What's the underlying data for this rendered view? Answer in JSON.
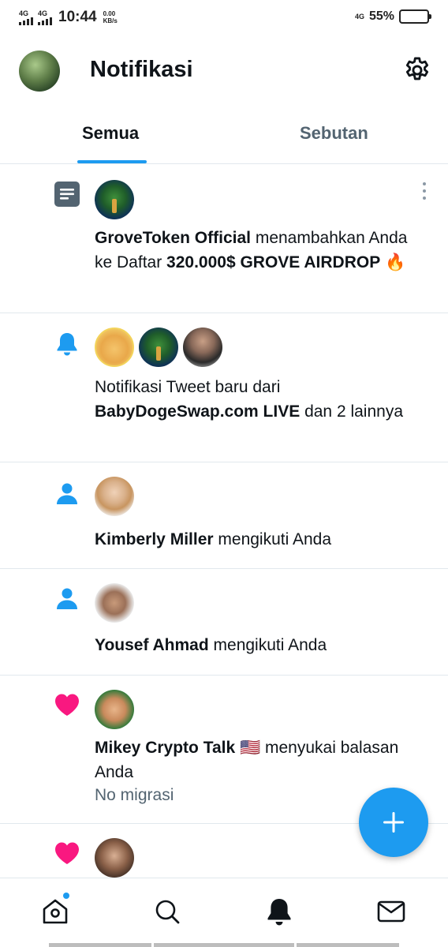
{
  "status_bar": {
    "net1": "4G",
    "net2": "4G",
    "time": "10:44",
    "speed_value": "0.00",
    "speed_unit": "KB/s",
    "net3": "4G",
    "battery_percent": "55%",
    "battery_level": 0.55
  },
  "header": {
    "title": "Notifikasi",
    "settings_icon": "gear-icon"
  },
  "tabs": [
    {
      "label": "Semua",
      "selected": true
    },
    {
      "label": "Sebutan",
      "selected": false
    }
  ],
  "notifications": [
    {
      "icon": "list-icon",
      "parts": [
        {
          "text": "GroveToken Official",
          "bold": true
        },
        {
          "text": " menambahkan Anda ke Daftar ",
          "bold": false
        },
        {
          "text": "320.000$ GROVE AIRDROP",
          "bold": true
        },
        {
          "text": " 🔥",
          "bold": false
        }
      ]
    },
    {
      "icon": "bell-icon",
      "parts": [
        {
          "text": "Notifikasi Tweet baru dari ",
          "bold": false
        },
        {
          "text": "BabyDogeSwap.com LIVE",
          "bold": true
        },
        {
          "text": " dan 2 lainnya",
          "bold": false
        }
      ]
    },
    {
      "icon": "person-icon",
      "parts": [
        {
          "text": "Kimberly Miller",
          "bold": true
        },
        {
          "text": " mengikuti Anda",
          "bold": false
        }
      ]
    },
    {
      "icon": "person-icon",
      "parts": [
        {
          "text": "Yousef Ahmad",
          "bold": true
        },
        {
          "text": " mengikuti Anda",
          "bold": false
        }
      ]
    },
    {
      "icon": "heart-icon",
      "parts": [
        {
          "text": "Mikey Crypto Talk",
          "bold": true
        },
        {
          "text": " 🇺🇸 menyukai balasan Anda",
          "bold": false
        }
      ],
      "subtext": "No migrasi"
    },
    {
      "icon": "heart-icon",
      "parts": []
    }
  ],
  "colors": {
    "accent": "#1d9bf0",
    "like": "#f91880",
    "secondary_text": "#536471",
    "list_icon": "#536471"
  },
  "bottom_nav": [
    {
      "name": "home-icon"
    },
    {
      "name": "search-icon"
    },
    {
      "name": "bell-icon"
    },
    {
      "name": "mail-icon"
    }
  ],
  "fab": {
    "icon": "plus-icon"
  }
}
